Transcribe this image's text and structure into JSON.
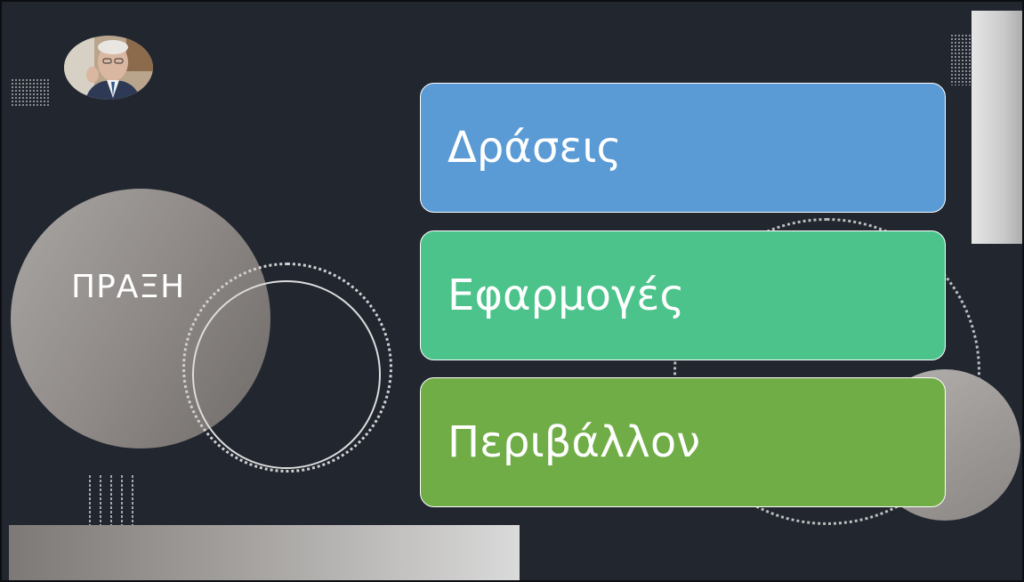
{
  "slide": {
    "label": "ΠΡΑΞΗ",
    "boxes": [
      {
        "text": "Δράσεις",
        "color": "#5b9bd5"
      },
      {
        "text": "Εφαρμογές",
        "color": "#4cc38b"
      },
      {
        "text": "Περιβάλλον",
        "color": "#70ad47"
      }
    ],
    "background_color": "#21262f",
    "avatar": "portrait-photo-icon"
  }
}
